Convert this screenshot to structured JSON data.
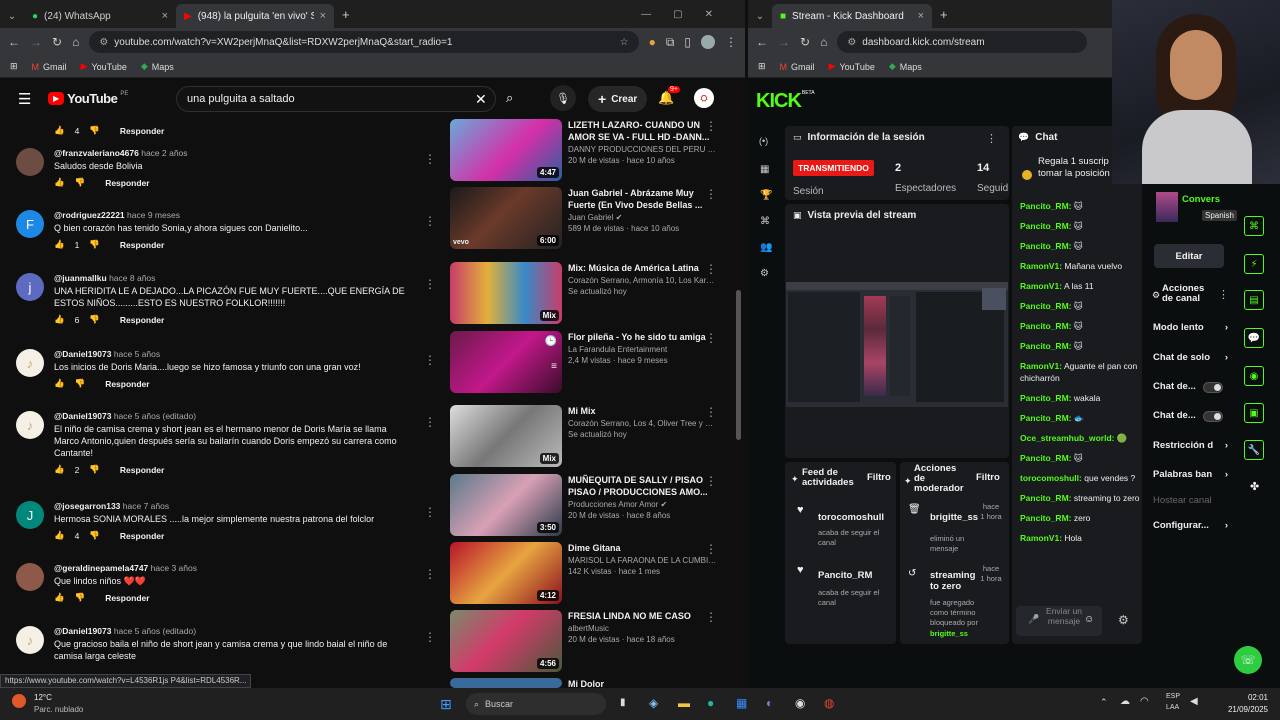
{
  "left_window": {
    "tabs": [
      {
        "label": "(24) WhatsApp"
      },
      {
        "label": "(948) la pulguita 'en vivo' SONI"
      }
    ],
    "url": "youtube.com/watch?v=XW2perjMnaQ&list=RDXW2perjMnaQ&start_radio=1",
    "bookmarks": [
      "Gmail",
      "YouTube",
      "Maps"
    ]
  },
  "youtube": {
    "logo": "YouTube",
    "logo_region": "PE",
    "search_value": "una pulguita a saltado",
    "create_label": "Crear",
    "notif_count": "9+",
    "reply_label": "Responder",
    "comments": [
      {
        "handle": "",
        "time": "",
        "text": "",
        "likes": "4"
      },
      {
        "handle": "@franzvaleriano4676",
        "time": "hace 2 años",
        "text": "Saludos desde Bolivia",
        "likes": ""
      },
      {
        "handle": "@rodriguez22221",
        "time": "hace 9 meses",
        "text": "Q bien corazón has tenido Sonia,y ahora sigues con Danielito...",
        "likes": "1"
      },
      {
        "handle": "@juanmallku",
        "time": "hace 8 años",
        "text": "UNA HERIDITA LE A DEJADO...LA PICAZÓN FUE MUY FUERTE....QUE ENERGÍA DE ESTOS NIÑOS.........ESTO ES NUESTRO FOLKLOR!!!!!!!",
        "likes": "6"
      },
      {
        "handle": "@Daniel19073",
        "time": "hace 5 años",
        "text": "Los inicios de Doris Maria....luego se hizo famosa y triunfo con una gran voz!",
        "likes": ""
      },
      {
        "handle": "@Daniel19073",
        "time": "hace 5 años (editado)",
        "text": "El niño de camisa crema y short jean es el hermano menor de Doris María se llama Marco Antonio,quien después sería su bailarín cuando Doris empezó su carrera como Cantante!",
        "likes": "2"
      },
      {
        "handle": "@josegarron133",
        "time": "hace 7 años",
        "text": "Hermosa SONIA MORALES .....la mejor simplemente nuestra patrona del folclor",
        "likes": "4"
      },
      {
        "handle": "@geraldinepamela4747",
        "time": "hace 3 años",
        "text": "Que lindos niños ❤️❤️",
        "likes": ""
      },
      {
        "handle": "@Daniel19073",
        "time": "hace 5 años (editado)",
        "text": "Que gracioso baila el niño de short jean y camisa crema y que lindo baial el niño de camisa larga celeste",
        "likes": ""
      }
    ],
    "videos": [
      {
        "title": "LIZETH LAZARO- CUANDO UN AMOR SE VA - FULL HD -DANN...",
        "channel": "DANNY PRODUCCIONES DEL PERU OFIC...",
        "meta": "20 M de vistas · hace 10 años",
        "duration": "4:47"
      },
      {
        "title": "Juan Gabriel - Abrázame Muy Fuerte (En Vivo Desde Bellas ...",
        "channel": "Juan Gabriel ✔",
        "meta": "589 M de vistas · hace 10 años",
        "duration": "6:00"
      },
      {
        "title": "Mix: Música de América Latina",
        "channel": "Corazón Serrano, Armonía 10, Los Karkik...",
        "meta": "Se actualizó hoy",
        "duration": "Mix"
      },
      {
        "title": "Flor pileña - Yo he sido tu amiga",
        "channel": "La Farandula Entertainment",
        "meta": "2,4 M vistas · hace 9 meses",
        "duration": ""
      },
      {
        "title": "Mi Mix",
        "channel": "Corazón Serrano, Los 4, Oliver Tree y mu...",
        "meta": "Se actualizó hoy",
        "duration": "Mix"
      },
      {
        "title": "MUÑEQUITA DE SALLY / PISAO PISAO / PRODUCCIONES AMO...",
        "channel": "Producciones Amor Amor ✔",
        "meta": "20 M de vistas · hace 8 años",
        "duration": "3:50"
      },
      {
        "title": "Dime Gitana",
        "channel": "MARISOL LA FARAONA DE LA CUMBIA ✔",
        "meta": "142 K vistas · hace 1 mes",
        "duration": "4:12"
      },
      {
        "title": "FRESIA LINDA NO ME CASO",
        "channel": "albertMusic",
        "meta": "20 M de vistas · hace 18 años",
        "duration": "4:56"
      },
      {
        "title": "Mi Dolor",
        "channel": "",
        "meta": "",
        "duration": ""
      }
    ],
    "status_url": "https://www.youtube.com/watch?v=L4536R1js P4&list=RDL4536R..."
  },
  "right_window": {
    "tabs": [
      {
        "label": "Stream - Kick Dashboard"
      }
    ],
    "url": "dashboard.kick.com/stream",
    "bookmarks": [
      "Gmail",
      "YouTube",
      "Maps"
    ]
  },
  "kick": {
    "logo": "KICK",
    "logo_tag": "BETA",
    "session_title": "Información de la sesión",
    "live_badge": "TRANSMITIENDO",
    "session_label": "Sesión",
    "viewers_value": "2",
    "viewers_label": "Espectadores",
    "followers_value": "14",
    "followers_label": "Seguid",
    "preview_title": "Vista previa del stream",
    "chat_title": "Chat",
    "gift_text": "Regala 1 suscrip para tomar la posición 1",
    "chat": [
      {
        "user": "Pancito_RM:",
        "msg": "🐱"
      },
      {
        "user": "Pancito_RM:",
        "msg": "🐱"
      },
      {
        "user": "Pancito_RM:",
        "msg": "🐱"
      },
      {
        "user": "RamonV1:",
        "msg": "Mañana vuelvo"
      },
      {
        "user": "RamonV1:",
        "msg": "A las 11"
      },
      {
        "user": "Pancito_RM:",
        "msg": "🐱"
      },
      {
        "user": "Pancito_RM:",
        "msg": "🐱"
      },
      {
        "user": "Pancito_RM:",
        "msg": "🐱"
      },
      {
        "user": "RamonV1:",
        "msg": "Aguante el pan con chicharrón"
      },
      {
        "user": "Pancito_RM:",
        "msg": "wakala"
      },
      {
        "user": "Pancito_RM:",
        "msg": "🐟"
      },
      {
        "user": "Oce_streamhub_world:",
        "msg": "🟢"
      },
      {
        "user": "Pancito_RM:",
        "msg": "🐱"
      },
      {
        "user": "torocomoshull:",
        "msg": "que vendes ?"
      },
      {
        "user": "Pancito_RM:",
        "msg": "streaming to zero"
      },
      {
        "user": "Pancito_RM:",
        "msg": "zero"
      },
      {
        "user": "RamonV1:",
        "msg": "Hola"
      }
    ],
    "chat_placeholder": "Enviar un mensaje",
    "activity_title": "Feed de actividades",
    "filter_label": "Filtro",
    "activity": [
      {
        "user": "torocomoshull",
        "desc": "acaba de seguir el canal"
      },
      {
        "user": "Pancito_RM",
        "desc": "acaba de seguir el canal"
      }
    ],
    "mod_title": "Acciones de moderador",
    "mod_actions": [
      {
        "user": "brigitte_ss",
        "time": "hace 1 hora",
        "desc": "eliminó un mensaje"
      },
      {
        "user": "streaming to zero",
        "time": "hace 1 hora",
        "desc": "fue agregado como término bloqueado por",
        "by": "brigitte_ss"
      }
    ],
    "category": "Convers",
    "language": "Spanish",
    "edit_label": "Editar",
    "channel_actions_title": "Acciones de canal",
    "channel_actions": [
      "Modo lento",
      "Chat de solo",
      "Chat de...",
      "Chat de...",
      "Restricción d",
      "Palabras ban",
      "Hostear canal",
      "Configurar..."
    ]
  },
  "taskbar": {
    "temp": "12°C",
    "weather": "Parc. nublado",
    "search": "Buscar",
    "lang": "ESP",
    "lang2": "LAA",
    "time": "02:01",
    "date": "21/09/2025"
  },
  "colors": {
    "kick_green": "#53fc18",
    "yt_red": "#ff0000",
    "live_red": "#e91916"
  }
}
